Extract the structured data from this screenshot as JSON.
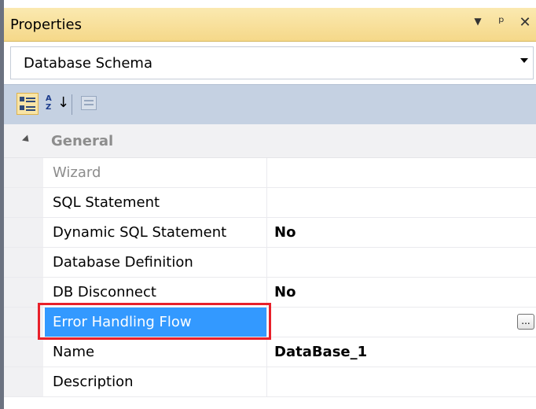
{
  "panel": {
    "title": "Properties",
    "title_icons": {
      "dropdown": "triangle-down-icon",
      "pin": "pin-icon",
      "close": "close-icon"
    }
  },
  "selector": {
    "value": "Database Schema"
  },
  "toolbar": {
    "buttons": [
      {
        "name": "categorized-icon",
        "active": true
      },
      {
        "name": "alphabetical-icon",
        "active": false
      },
      {
        "name": "property-pages-icon",
        "active": false
      }
    ],
    "az_text": "A\nZ"
  },
  "grid": {
    "category": "General",
    "rows": [
      {
        "name": "Wizard",
        "value": "",
        "disabled": true
      },
      {
        "name": "SQL Statement",
        "value": ""
      },
      {
        "name": "Dynamic SQL Statement",
        "value": "No"
      },
      {
        "name": "Database Definition",
        "value": ""
      },
      {
        "name": "DB Disconnect",
        "value": "No"
      },
      {
        "name": "Error Handling Flow",
        "value": "",
        "selected": true,
        "button": "..."
      },
      {
        "name": "Name",
        "value": "DataBase_1"
      },
      {
        "name": "Description",
        "value": ""
      }
    ]
  },
  "colors": {
    "title_bar": "#f5d889",
    "toolbar": "#c5d1e2",
    "selection": "#3399ff",
    "highlight_box": "#e8202a"
  }
}
